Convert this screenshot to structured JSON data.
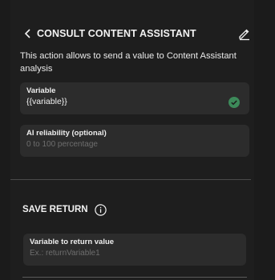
{
  "header": {
    "title": "CONSULT CONTENT ASSISTANT"
  },
  "description": "This action allows to send a value to Content Assistant analysis",
  "fields": {
    "variable": {
      "label": "Variable",
      "value": "{{variable}}"
    },
    "ai_reliability": {
      "label": "AI reliability (optional)",
      "placeholder": "0 to 100 percentage"
    },
    "return_variable": {
      "label": "Variable to return value",
      "placeholder": "Ex.: returnVariable1"
    }
  },
  "save_return": {
    "title": "SAVE RETURN"
  },
  "icons": {
    "back": "chevron-left-icon",
    "edit": "pencil-icon",
    "valid": "check-circle-icon",
    "info": "info-icon"
  },
  "colors": {
    "valid": "#3d8a5a",
    "field_bg": "#2c2c2c",
    "panel_bg": "#1e1e1e"
  }
}
